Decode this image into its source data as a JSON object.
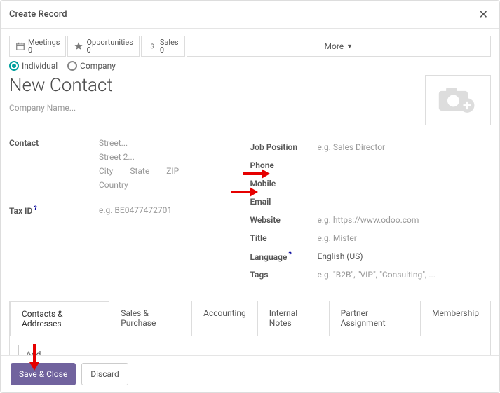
{
  "modal": {
    "title": "Create Record"
  },
  "stats": {
    "meetings": {
      "label": "Meetings",
      "count": "0"
    },
    "opps": {
      "label": "Opportunities",
      "count": "0"
    },
    "sales": {
      "label": "Sales",
      "count": "0"
    },
    "more": "More"
  },
  "type": {
    "individual": "Individual",
    "company": "Company",
    "selected": "individual"
  },
  "name_value": "New Contact",
  "company_placeholder": "Company Name...",
  "labels": {
    "contact": "Contact",
    "taxid": "Tax ID",
    "job": "Job Position",
    "phone": "Phone",
    "mobile": "Mobile",
    "email": "Email",
    "website": "Website",
    "title": "Title",
    "language": "Language",
    "tags": "Tags"
  },
  "placeholders": {
    "street": "Street...",
    "street2": "Street 2...",
    "city": "City",
    "state": "State",
    "zip": "ZIP",
    "country": "Country",
    "taxid": "e.g. BE0477472701",
    "job": "e.g. Sales Director",
    "website": "e.g. https://www.odoo.com",
    "title": "e.g. Mister",
    "tags": "e.g. \"B2B\", \"VIP\", \"Consulting\", ..."
  },
  "values": {
    "language": "English (US)"
  },
  "tabs": {
    "t0": "Contacts & Addresses",
    "t1": "Sales & Purchase",
    "t2": "Accounting",
    "t3": "Internal Notes",
    "t4": "Partner Assignment",
    "t5": "Membership"
  },
  "add_btn": "Add",
  "save_close": "Save & Close",
  "discard": "Discard"
}
